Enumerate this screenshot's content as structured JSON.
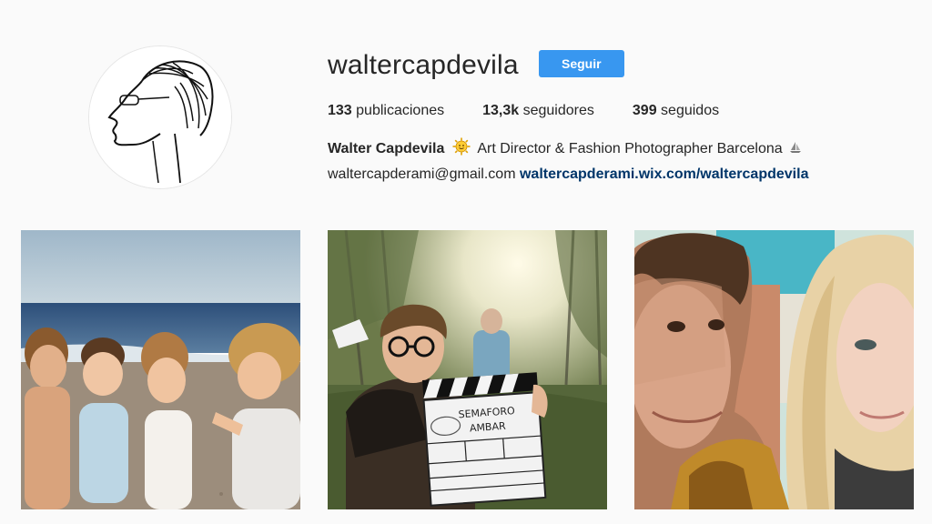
{
  "profile": {
    "username": "waltercapdevila",
    "follow_label": "Seguir",
    "avatar_icon": "sketch-portrait-avatar"
  },
  "stats": {
    "posts_count": "133",
    "posts_label": "publicaciones",
    "followers_count": "13,3k",
    "followers_label": "seguidores",
    "following_count": "399",
    "following_label": "seguidos"
  },
  "bio": {
    "full_name": "Walter Capdevila",
    "description": "Art Director & Fashion Photographer Barcelona",
    "emoji_icon": "sun-face-emoji-icon",
    "trailing_icon": "sailboat-icon",
    "email": "waltercapderami@gmail.com",
    "link": "waltercapderami.wix.com/waltercapdevila"
  },
  "posts": [
    {
      "icon": "beach-children-photo"
    },
    {
      "icon": "film-set-clapperboard-photo",
      "clapper_title": "SEMAFORO",
      "clapper_subtitle": "AMBAR"
    },
    {
      "icon": "couple-selfie-photo"
    }
  ],
  "colors": {
    "accent": "#3897f0",
    "link": "#003569",
    "background": "#fafafa"
  }
}
